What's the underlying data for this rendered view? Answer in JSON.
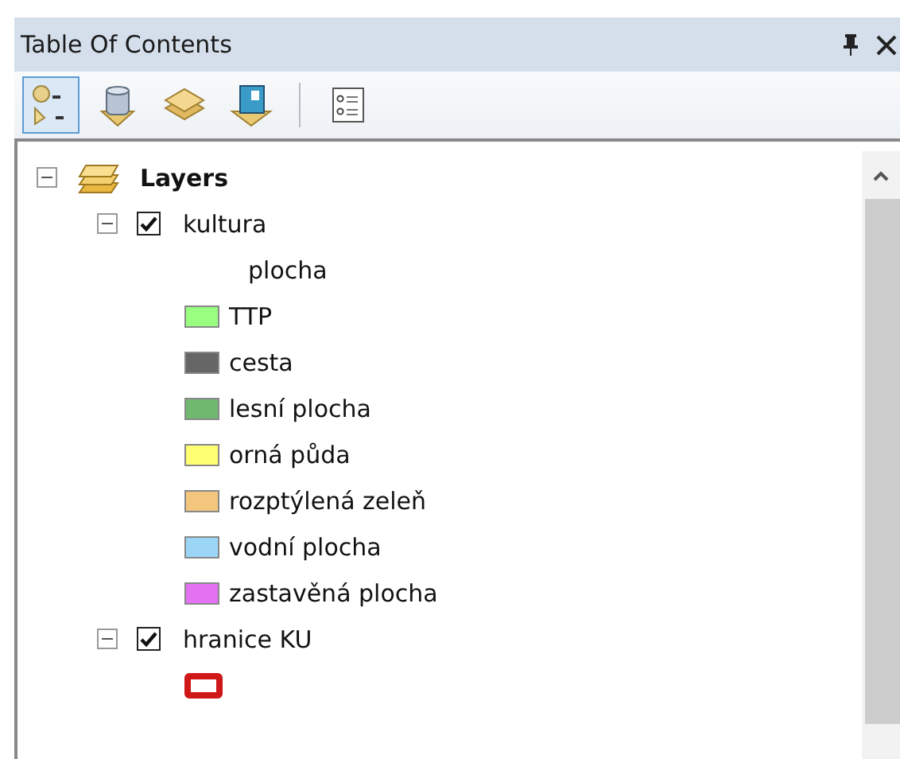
{
  "window": {
    "title": "Table Of Contents"
  },
  "toolbar": [
    {
      "kind": "drawing-order",
      "selected": true
    },
    {
      "kind": "source",
      "selected": false
    },
    {
      "kind": "visibility",
      "selected": false
    },
    {
      "kind": "selection",
      "selected": false
    },
    {
      "kind": "options",
      "selected": false,
      "separator_before": true
    }
  ],
  "tree": [
    {
      "kind": "group",
      "label": "Layers",
      "expanded": true,
      "children": [
        {
          "kind": "layer",
          "label": "kultura",
          "checked": true,
          "expanded": true,
          "children": [
            {
              "kind": "heading",
              "label": "plocha"
            },
            {
              "kind": "fill",
              "label": "TTP",
              "color": "#99ff80"
            },
            {
              "kind": "fill",
              "label": "cesta",
              "color": "#666666"
            },
            {
              "kind": "fill",
              "label": "lesní plocha",
              "color": "#70b870"
            },
            {
              "kind": "fill",
              "label": "orná půda",
              "color": "#ffff73"
            },
            {
              "kind": "fill",
              "label": "rozptýlená zeleň",
              "color": "#f2c67c"
            },
            {
              "kind": "fill",
              "label": "vodní plocha",
              "color": "#9cd6f7"
            },
            {
              "kind": "fill",
              "label": "zastavěná plocha",
              "color": "#e472f2"
            }
          ]
        },
        {
          "kind": "layer",
          "label": "hranice KU",
          "checked": true,
          "expanded": true,
          "children": [
            {
              "kind": "outline",
              "color": "#d01818"
            }
          ]
        }
      ]
    }
  ]
}
